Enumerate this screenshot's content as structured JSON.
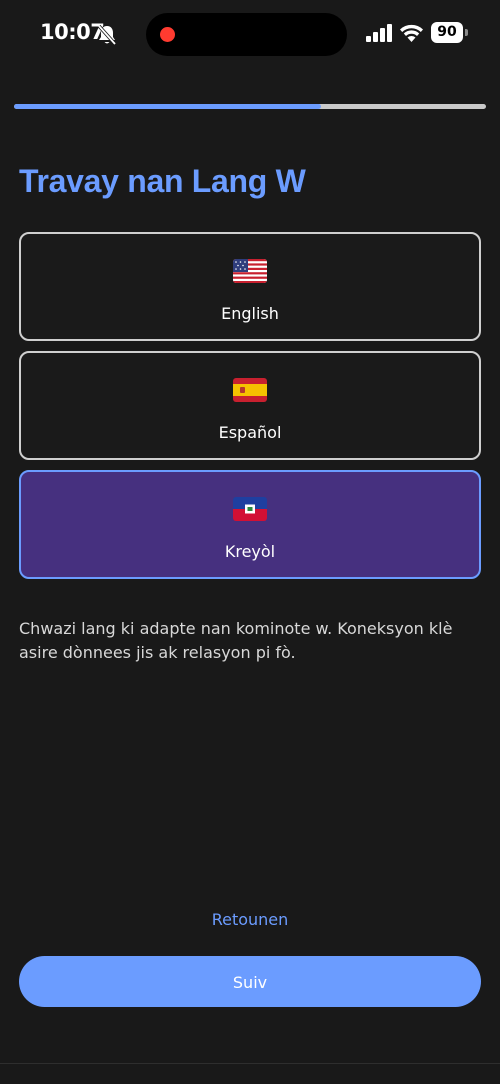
{
  "status_bar": {
    "time": "10:07",
    "battery": "90"
  },
  "progress": {
    "fraction": 0.65
  },
  "title": "Travay nan Lang W",
  "languages": [
    {
      "label": "English",
      "flag": "us-flag-icon",
      "selected": false
    },
    {
      "label": "Español",
      "flag": "spain-flag-icon",
      "selected": false
    },
    {
      "label": "Kreyòl",
      "flag": "haiti-flag-icon",
      "selected": true
    }
  ],
  "description": "Chwazi lang ki adapte nan kominote w. Koneksyon klè asire dònnees jis ak relasyon pi fò.",
  "actions": {
    "back_label": "Retounen",
    "next_label": "Suiv"
  },
  "colors": {
    "accent": "#6b9cff",
    "selected_card": "#46307f",
    "background": "#191919"
  }
}
